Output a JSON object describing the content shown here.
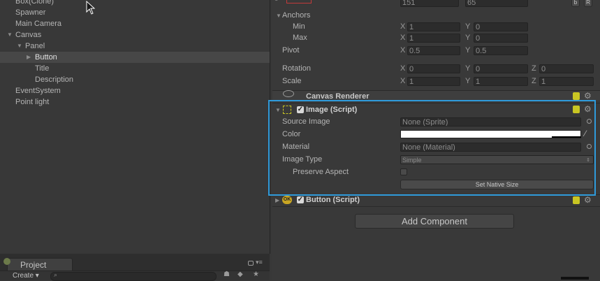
{
  "hierarchy": {
    "items": [
      {
        "label": "Box(Clone)",
        "indent": 0,
        "arrow": ""
      },
      {
        "label": "Spawner",
        "indent": 0,
        "arrow": ""
      },
      {
        "label": "Main Camera",
        "indent": 0,
        "arrow": ""
      },
      {
        "label": "Canvas",
        "indent": 0,
        "arrow": "▼"
      },
      {
        "label": "Panel",
        "indent": 1,
        "arrow": "▼"
      },
      {
        "label": "Button",
        "indent": 2,
        "arrow": "▶"
      },
      {
        "label": "Title",
        "indent": 2,
        "arrow": ""
      },
      {
        "label": "Description",
        "indent": 2,
        "arrow": ""
      },
      {
        "label": "EventSystem",
        "indent": 0,
        "arrow": ""
      },
      {
        "label": "Point light",
        "indent": 0,
        "arrow": ""
      }
    ]
  },
  "project": {
    "tab_label": "Project",
    "create_label": "Create ▾",
    "search_placeholder": ""
  },
  "inspector": {
    "rect_top": {
      "width": "151",
      "height": "65",
      "b_label": "b",
      "r_label": "R"
    },
    "anchors": {
      "label": "Anchors",
      "min_label": "Min",
      "min_x": "1",
      "min_y": "0",
      "max_label": "Max",
      "max_x": "1",
      "max_y": "0"
    },
    "pivot": {
      "label": "Pivot",
      "x": "0.5",
      "y": "0.5"
    },
    "rotation": {
      "label": "Rotation",
      "x": "0",
      "y": "0",
      "z": "0"
    },
    "scale": {
      "label": "Scale",
      "x": "1",
      "y": "1",
      "z": "1"
    },
    "axis": {
      "x": "X",
      "y": "Y",
      "z": "Z"
    },
    "canvas_renderer": {
      "title": "Canvas Renderer"
    },
    "image_script": {
      "title": "Image (Script)",
      "source_image_label": "Source Image",
      "source_image_value": "None (Sprite)",
      "color_label": "Color",
      "material_label": "Material",
      "material_value": "None (Material)",
      "image_type_label": "Image Type",
      "image_type_value": "Simple",
      "preserve_aspect_label": "Preserve Aspect",
      "set_native_size_label": "Set Native Size"
    },
    "button_script": {
      "title": "Button (Script)",
      "icon_text": "OK"
    },
    "add_component_label": "Add Component"
  }
}
